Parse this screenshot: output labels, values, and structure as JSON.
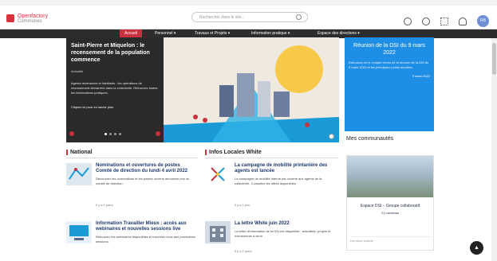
{
  "browser": {
    "left": "",
    "right": ""
  },
  "header": {
    "logo_line1": "Openfactory",
    "logo_line2": "Communes",
    "search_placeholder": "Rechercher dans le site...",
    "avatar_initials": "RB"
  },
  "nav": {
    "items": [
      {
        "label": "Accueil",
        "active": true
      },
      {
        "label": "Personnel ▾",
        "active": false
      },
      {
        "label": "Travaux et Projets ▾",
        "active": false
      },
      {
        "label": "Information pratique ▾",
        "active": false
      },
      {
        "label": "Espace des directions ▾",
        "active": false
      }
    ]
  },
  "hero": {
    "title": "Saint-Pierre et Miquelon : le recensement de la population commence",
    "tag": "Actualité",
    "body": "Agents recenseurs et habitants : les opérations de recensement démarrent dans la collectivité. Retrouvez toutes les informations pratiques.",
    "link": "Cliquez ici pour en savoir plus"
  },
  "sidebar": {
    "heading": "Réunion de la DSI du 9 mars 2022",
    "paragraph": "Retrouvez ici le compte rendu de la réunion de la DSI du 9 mars 2022 et les principaux points abordés.",
    "date": "9 mars 2022"
  },
  "communes": {
    "heading": "Mes communautés",
    "card_title": "Espace DSI – Groupe collaboratif",
    "card_sub": "21 membres",
    "card_foot": "Dernière activité"
  },
  "sections": {
    "national": "National",
    "locales": "Infos Locales White"
  },
  "national_articles": [
    {
      "title": "Nominations et ouvertures de postes Comité de direction du lundi 4 avril 2022",
      "body": "Découvrez les nominations et les postes ouverts annoncés lors du comité de direction.",
      "date": "Il y a 2 jours"
    },
    {
      "title": "Information Travailler Mieux : accès aux webinaires et nouvelles sessions live",
      "body": "Retrouvez les webinaires disponibles et inscrivez-vous aux prochaines sessions.",
      "date": "Il y a 3 jours"
    }
  ],
  "local_articles": [
    {
      "title": "La campagne de mobilité printanière des agents est lancée",
      "body": "La campagne de mobilité interne est ouverte aux agents de la collectivité. Consultez les offres disponibles.",
      "date": "Il y a 1 jour"
    },
    {
      "title": "La lettre White juin 2022",
      "body": "La lettre d'information de la DSI est disponible : actualités, projets et événements à venir.",
      "date": "Il y a 2 jours"
    }
  ],
  "colors": {
    "accent": "#c8323e",
    "blue": "#1f8fe5",
    "nav": "#2d2d2d"
  }
}
